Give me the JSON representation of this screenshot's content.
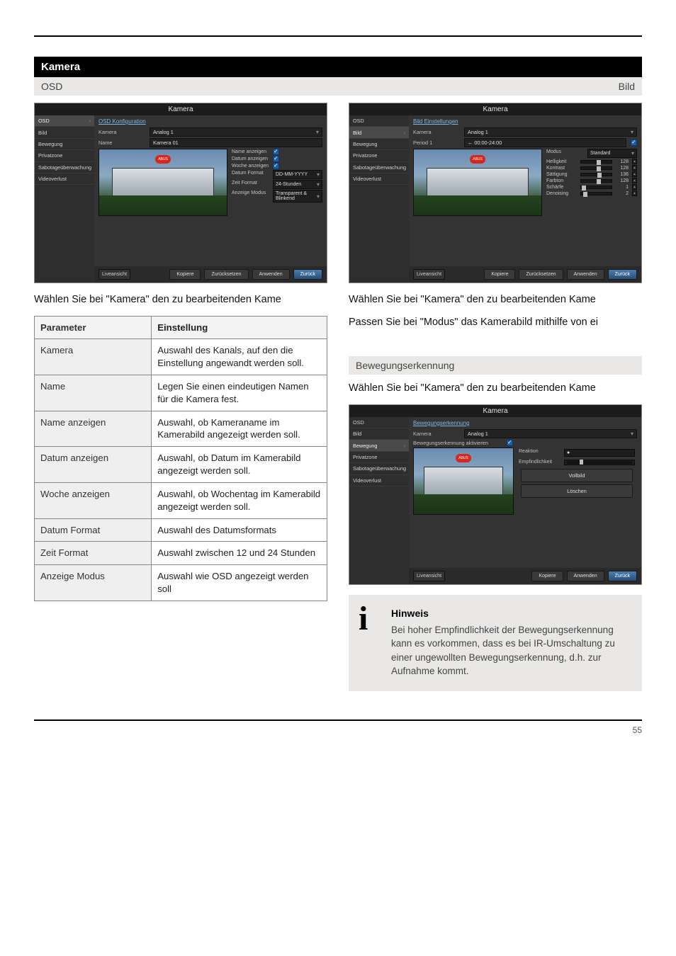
{
  "section": {
    "title": "Kamera",
    "sub": "OSD"
  },
  "section_right": {
    "sub2": "Bild"
  },
  "section_motion_sub": "Bewegungserkennung",
  "left": {
    "caption": "Wählen Sie bei \"Kamera\" den zu bearbeitenden Kame",
    "shot": {
      "titlebar": "Kamera",
      "menu": [
        "OSD",
        "Bild",
        "Bewegung",
        "Privatzone",
        "Sabotageüberwachung",
        "Videoverlust"
      ],
      "active": 0,
      "header": "OSD Konfiguration",
      "rows": {
        "kamera_lbl": "Kamera",
        "kamera_val": "Analog 1",
        "name_lbl": "Name",
        "name_val": "Kamera 01"
      },
      "kv": [
        {
          "k": "Name anzeigen",
          "chk": true
        },
        {
          "k": "Datum anzeigen",
          "chk": true
        },
        {
          "k": "Woche anzeigen",
          "chk": true
        },
        {
          "k": "Datum Format",
          "v": "DD-MM-YYYY"
        },
        {
          "k": "Zeit Format",
          "v": "24-Stunden"
        },
        {
          "k": "Anzeige Modus",
          "v": "Transparent & Blinkend"
        }
      ],
      "footer": {
        "left": "Liveansicht",
        "buttons": [
          "Kopiere",
          "Zurücksetzen",
          "Anwenden"
        ],
        "primary": "Zurück"
      }
    },
    "table": {
      "head": [
        "Parameter",
        "Einstellung"
      ],
      "rows": [
        [
          "Kamera",
          "Auswahl des Kanals, auf den die Einstellung angewandt werden soll."
        ],
        [
          "Name",
          "Legen Sie einen eindeutigen Namen für die Kamera fest."
        ],
        [
          "Name anzeigen",
          "Auswahl, ob Kameraname im Kamerabild angezeigt werden soll."
        ],
        [
          "Datum anzeigen",
          "Auswahl, ob Datum im Kamerabild angezeigt werden soll."
        ],
        [
          "Woche anzeigen",
          "Auswahl, ob Wochentag im Kamerabild angezeigt werden soll."
        ],
        [
          "Datum Format",
          "Auswahl des Datumsformats"
        ],
        [
          "Zeit Format",
          "Auswahl zwischen 12 und 24 Stunden"
        ],
        [
          "Anzeige Modus",
          "Auswahl wie OSD angezeigt werden soll"
        ]
      ]
    }
  },
  "right": {
    "caption1": "Wählen Sie bei \"Kamera\" den zu bearbeitenden Kame",
    "caption2": "Passen Sie bei \"Modus\" das Kamerabild mithilfe von ei",
    "shot": {
      "titlebar": "Kamera",
      "menu": [
        "OSD",
        "Bild",
        "Bewegung",
        "Privatzone",
        "Sabotageüberwachung",
        "Videoverlust"
      ],
      "active": 1,
      "header": "Bild Einstellungen",
      "rows": {
        "kamera_lbl": "Kamera",
        "kamera_val": "Analog 1",
        "period_lbl": "Period 1",
        "period_val": "00:00-24:00",
        "period_chk": true
      },
      "mode_lbl": "Modus",
      "mode_val": "Standard",
      "sliders": [
        {
          "k": "Helligkeit",
          "v": 128
        },
        {
          "k": "Kontrast",
          "v": 128
        },
        {
          "k": "Sättigung",
          "v": 136
        },
        {
          "k": "Farbton",
          "v": 128
        },
        {
          "k": "Schärfe",
          "v": 1
        },
        {
          "k": "Denoising",
          "v": 2
        }
      ],
      "footer": {
        "left": "Liveansicht",
        "buttons": [
          "Kopiere",
          "Zurücksetzen",
          "Anwenden"
        ],
        "primary": "Zurück"
      }
    },
    "motion_caption": "Wählen Sie bei \"Kamera\" den zu bearbeitenden Kame",
    "motion_shot": {
      "titlebar": "Kamera",
      "menu": [
        "OSD",
        "Bild",
        "Bewegung",
        "Privatzone",
        "Sabotageüberwachung",
        "Videoverlust"
      ],
      "active": 2,
      "header": "Bewegungserkennung",
      "rows": {
        "kamera_lbl": "Kamera",
        "kamera_val": "Analog 1",
        "enable_lbl": "Bewegungserkennung aktivieren"
      },
      "panel": {
        "r1k": "Reaktion",
        "r1v": "●",
        "r2k": "Empfindlichkeit",
        "r2v": "",
        "b1": "Vollbild",
        "b2": "Löschen"
      },
      "footer": {
        "left": "Liveansicht",
        "buttons": [
          "Kopiere",
          "Anwenden"
        ],
        "primary": "Zurück"
      }
    }
  },
  "note": {
    "heading": "Hinweis",
    "body": "Bei hoher Empfindlichkeit der Bewegungserkennung kann es vorkommen, dass es bei IR-Umschaltung zu einer ungewollten Bewegungserkennung, d.h. zur Aufnahme kommt."
  },
  "page_number": "55"
}
